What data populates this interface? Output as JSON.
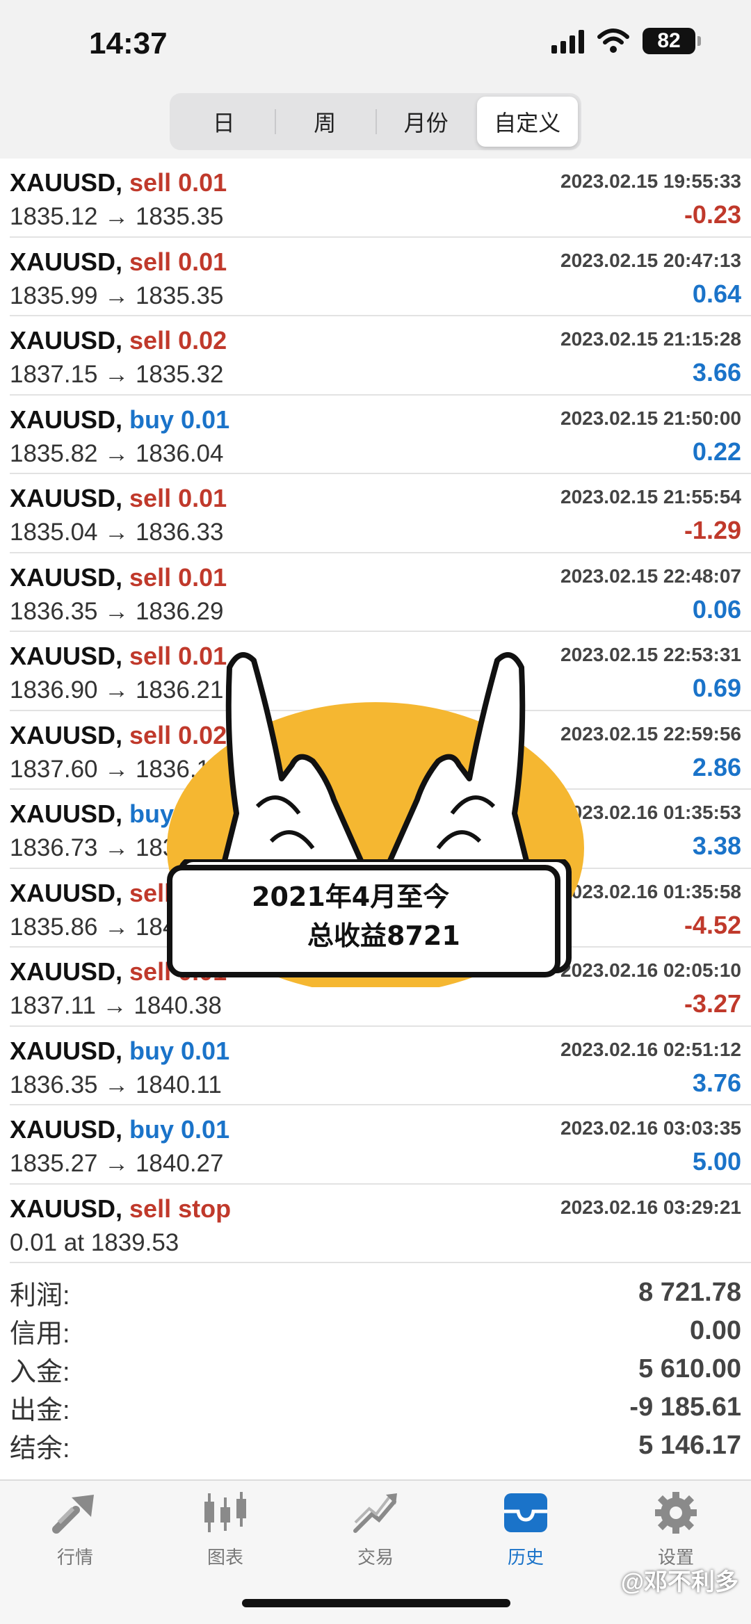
{
  "status": {
    "time": "14:37",
    "battery": "82"
  },
  "segments": {
    "items": [
      "日",
      "周",
      "月份",
      "自定义"
    ],
    "active": "自定义"
  },
  "trades": [
    {
      "symbol": "XAUUSD,",
      "type": "sell 0.01",
      "side": "sell",
      "price": "1835.12 → 1835.35",
      "time": "2023.02.15 19:55:33",
      "profit": "-0.23"
    },
    {
      "symbol": "XAUUSD,",
      "type": "sell 0.01",
      "side": "sell",
      "price": "1835.99 → 1835.35",
      "time": "2023.02.15 20:47:13",
      "profit": "0.64"
    },
    {
      "symbol": "XAUUSD,",
      "type": "sell 0.02",
      "side": "sell",
      "price": "1837.15 → 1835.32",
      "time": "2023.02.15 21:15:28",
      "profit": "3.66"
    },
    {
      "symbol": "XAUUSD,",
      "type": "buy 0.01",
      "side": "buy",
      "price": "1835.82 → 1836.04",
      "time": "2023.02.15 21:50:00",
      "profit": "0.22"
    },
    {
      "symbol": "XAUUSD,",
      "type": "sell 0.01",
      "side": "sell",
      "price": "1835.04 → 1836.33",
      "time": "2023.02.15 21:55:54",
      "profit": "-1.29"
    },
    {
      "symbol": "XAUUSD,",
      "type": "sell 0.01",
      "side": "sell",
      "price": "1836.35 → 1836.29",
      "time": "2023.02.15 22:48:07",
      "profit": "0.06"
    },
    {
      "symbol": "XAUUSD,",
      "type": "sell 0.01",
      "side": "sell",
      "price": "1836.90 → 1836.21",
      "time": "2023.02.15 22:53:31",
      "profit": "0.69"
    },
    {
      "symbol": "XAUUSD,",
      "type": "sell 0.02",
      "side": "sell",
      "price": "1837.60 → 1836.17",
      "time": "2023.02.15 22:59:56",
      "profit": "2.86"
    },
    {
      "symbol": "XAUUSD,",
      "type": "buy 0.01",
      "side": "buy",
      "price": "1836.73 → 1836.71",
      "time": "2023.02.16 01:35:53",
      "profit": "3.38"
    },
    {
      "symbol": "XAUUSD,",
      "type": "sell 0.01",
      "side": "sell",
      "price": "1835.86 → 1840.38",
      "time": "2023.02.16 01:35:58",
      "profit": "-4.52"
    },
    {
      "symbol": "XAUUSD,",
      "type": "sell 0.01",
      "side": "sell",
      "price": "1837.11 → 1840.38",
      "time": "2023.02.16 02:05:10",
      "profit": "-3.27"
    },
    {
      "symbol": "XAUUSD,",
      "type": "buy 0.01",
      "side": "buy",
      "price": "1836.35 → 1840.11",
      "time": "2023.02.16 02:51:12",
      "profit": "3.76"
    },
    {
      "symbol": "XAUUSD,",
      "type": "buy 0.01",
      "side": "buy",
      "price": "1835.27 → 1840.27",
      "time": "2023.02.16 03:03:35",
      "profit": "5.00"
    },
    {
      "symbol": "XAUUSD,",
      "type": "sell stop",
      "side": "sell",
      "price": "0.01 at 1839.53",
      "time": "2023.02.16 03:29:21",
      "profit": ""
    }
  ],
  "summary": [
    {
      "label": "利润:",
      "value": "8 721.78"
    },
    {
      "label": "信用:",
      "value": "0.00"
    },
    {
      "label": "入金:",
      "value": "5 610.00"
    },
    {
      "label": "出金:",
      "value": "-9 185.61"
    },
    {
      "label": "结余:",
      "value": "5 146.17"
    }
  ],
  "overlay": {
    "line1": "2021年4月至今",
    "line2": "总收益8721"
  },
  "tabs": [
    {
      "label": "行情",
      "icon": "quotes-icon"
    },
    {
      "label": "图表",
      "icon": "chart-icon"
    },
    {
      "label": "交易",
      "icon": "trade-icon"
    },
    {
      "label": "历史",
      "icon": "history-icon",
      "active": true
    },
    {
      "label": "设置",
      "icon": "settings-icon"
    }
  ],
  "watermark": "@邓不利多",
  "colors": {
    "sell": "#c0392b",
    "buy": "#1a73c9",
    "accent": "#1a73c9",
    "sticker_yellow": "#f5b731"
  }
}
